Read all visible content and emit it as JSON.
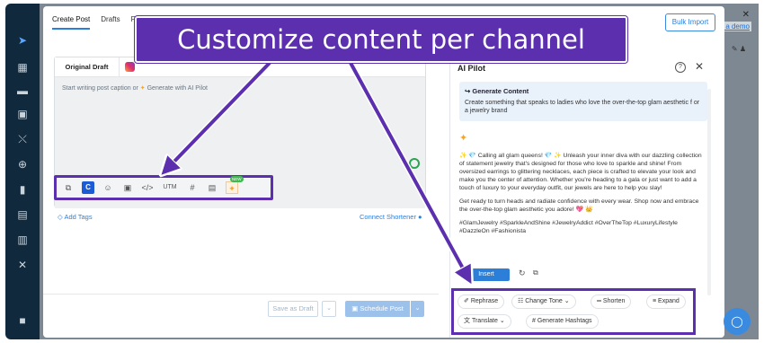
{
  "nav": {
    "icons": [
      "send-icon",
      "grid-icon",
      "chat-icon",
      "calendar-icon",
      "chart-icon",
      "target-icon",
      "bar-chart-icon",
      "inbox-icon",
      "library-icon",
      "tools-icon",
      "briefcase-icon"
    ]
  },
  "header": {
    "demo_link": "e a demo",
    "window_close": "✕"
  },
  "modal": {
    "tabs": [
      {
        "label": "Create Post",
        "active": true
      },
      {
        "label": "Drafts",
        "active": false
      },
      {
        "label": "Fe",
        "active": false
      }
    ],
    "bulk_import": "Bulk Import",
    "close": "✕"
  },
  "editor": {
    "tab_original": "Original Draft",
    "placeholder": "Start writing post caption or",
    "placeholder_ai": "Generate with AI Pilot",
    "toolbar": {
      "utm": "UTM",
      "new_badge": "NEW"
    },
    "add_tags": "Add Tags",
    "connect_shortener": "Connect Shortener"
  },
  "footer": {
    "save_draft": "Save as Draft",
    "schedule": "Schedule Post"
  },
  "ai_panel": {
    "title": "AI Pilot",
    "generate_title": "Generate Content",
    "prompt": "Create something that speaks to ladies who love the over-the-top glam aesthetic f or a jewelry brand",
    "result_p1": "✨ 💎 Calling all glam queens! 💎 ✨ Unleash your inner diva with our dazzling collection of statement jewelry that's designed for those who love to sparkle and shine! From oversized earrings to glittering necklaces, each piece is crafted to elevate your look and make you the center of attention. Whether you're heading to a gala or just want to add a touch of luxury to your everyday outfit, our jewels are here to help you slay!",
    "result_p2": "Get ready to turn heads and radiate confidence with every wear. Shop now and embrace the over-the-top glam aesthetic you adore! 💖 👑",
    "result_p3": "#GlamJewelry #SparkleAndShine #JewelryAddict #OverTheTop #LuxuryLifestyle #DazzleOn #Fashionista",
    "insert": "Insert",
    "actions": [
      "Rephrase",
      "Change Tone",
      "Shorten",
      "Expand",
      "Translate",
      "Generate Hashtags"
    ]
  },
  "banner": {
    "text": "Customize content per channel"
  },
  "colors": {
    "accent": "#5c2fae",
    "primary": "#2c7fd9",
    "nav_bg": "#10293c"
  }
}
